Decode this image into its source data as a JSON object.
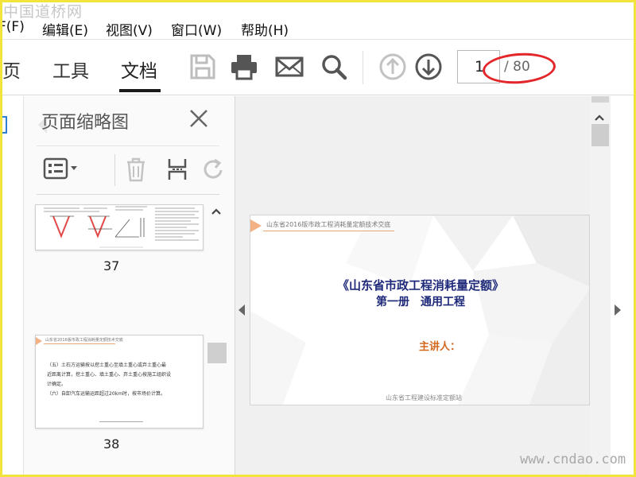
{
  "watermark_top": "中国道桥网",
  "watermark_bottom": "www.cndao.com",
  "menu": [
    "F(F)",
    "编辑(E)",
    "视图(V)",
    "窗口(W)",
    "帮助(H)"
  ],
  "toolbar": {
    "tabs": [
      "页",
      "工具",
      "文档"
    ],
    "active_tab": "文档",
    "icons": [
      "save-icon",
      "print-icon",
      "mail-icon",
      "search-icon",
      "page-up-icon",
      "page-down-icon"
    ],
    "page_current": "1",
    "page_total": "/ 80"
  },
  "thumbnails_panel": {
    "title": "页面缩略图",
    "pages": [
      {
        "number": "37"
      },
      {
        "number": "38",
        "header": "山东省2016版市政工程消耗量定额技术交底",
        "lines": [
          "（五）土石方运输按以挖土重心至填土重心或弃土重心最",
          "近距离计算，挖土重心、填土重心、弃土重心按施工组织设",
          "计确定。",
          "（六）自卸汽车运输运距超过20km时，按市场价计算。"
        ]
      }
    ]
  },
  "slide": {
    "header": "山东省2016版市政工程消耗量定额技术交底",
    "title_line1": "《山东省市政工程消耗量定额》",
    "title_line2": "第一册　通用工程",
    "speaker": "主讲人：",
    "footer": "山东省工程建设标准定额站"
  },
  "colors": {
    "frame": "#f3e33a",
    "annotation_circle": "#e2262a",
    "slide_title": "#1f2a7a",
    "speaker": "#d2691e"
  }
}
